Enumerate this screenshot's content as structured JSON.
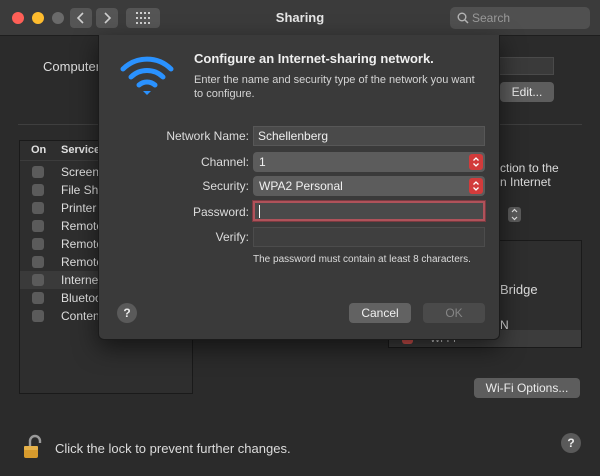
{
  "window": {
    "title": "Sharing"
  },
  "search": {
    "placeholder": "Search"
  },
  "background": {
    "computer_label": "Computer",
    "edit_button": "Edit...",
    "services": {
      "col_on": "On",
      "col_service": "Service",
      "items": [
        {
          "label": "Screen",
          "checked": false,
          "selected": false
        },
        {
          "label": "File Sha",
          "checked": false,
          "selected": false
        },
        {
          "label": "Printer",
          "checked": false,
          "selected": false
        },
        {
          "label": "Remote",
          "checked": false,
          "selected": false
        },
        {
          "label": "Remote",
          "checked": false,
          "selected": false
        },
        {
          "label": "Remote",
          "checked": false,
          "selected": false
        },
        {
          "label": "Internet",
          "checked": false,
          "selected": true
        },
        {
          "label": "Bluetoo",
          "checked": false,
          "selected": false
        },
        {
          "label": "Content",
          "checked": false,
          "selected": false
        }
      ]
    },
    "right_text": {
      "line1": "ction to the",
      "line2": "n Internet"
    },
    "interfaces": {
      "bridge": "Bridge",
      "n": "N",
      "wifi": "Wi-Fi"
    },
    "wifi_options_button": "Wi-Fi Options...",
    "lock_text": "Click the lock to prevent further changes.",
    "help": "?"
  },
  "sheet": {
    "title": "Configure an Internet-sharing network.",
    "description": "Enter the name and security type of the network you want to configure.",
    "fields": {
      "network_name": {
        "label": "Network Name:",
        "value": "Schellenberg"
      },
      "channel": {
        "label": "Channel:",
        "value": "1"
      },
      "security": {
        "label": "Security:",
        "value": "WPA2 Personal"
      },
      "password": {
        "label": "Password:",
        "value": ""
      },
      "verify": {
        "label": "Verify:",
        "value": ""
      }
    },
    "hint": "The password must contain at least 8 characters.",
    "help": "?",
    "cancel": "Cancel",
    "ok": "OK"
  },
  "colors": {
    "accent_wifi": "#1e90ff",
    "popup_stepper": "#d23b3b",
    "focus_ring": "#b0525a"
  }
}
